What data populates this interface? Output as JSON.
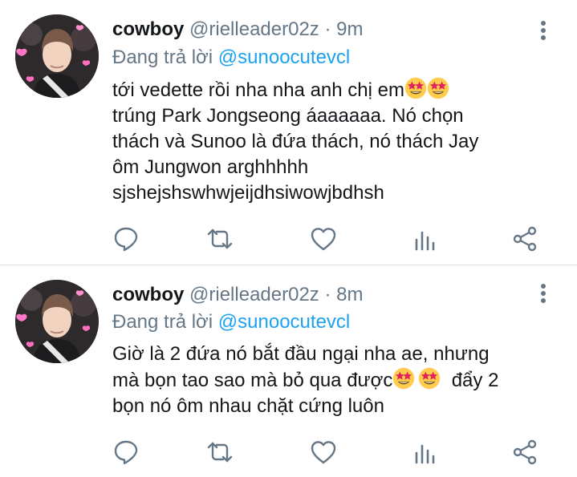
{
  "tweets": [
    {
      "display_name": "cowboy",
      "handle": "@rielleader02z",
      "separator": "·",
      "time": "9m",
      "reply_prefix": "Đang trả lời",
      "reply_to": "@sunoocutevcl",
      "lines": [
        "tới vedette rồi nha nha anh chị em",
        "trúng Park Jongseong áaaaaaa. Nó chọn",
        "thách và Sunoo là đứa thách, nó thách Jay",
        "ôm Jungwon arghhhhh",
        "sjshejshswhwjeijdhsiwowjbdhsh"
      ],
      "emoji": [
        "star-struck-emoji",
        "star-struck-emoji"
      ]
    },
    {
      "display_name": "cowboy",
      "handle": "@rielleader02z",
      "separator": "·",
      "time": "8m",
      "reply_prefix": "Đang trả lời",
      "reply_to": "@sunoocutevcl",
      "lines": [
        "Giờ là 2 đứa nó bắt đầu ngại nha ae, nhưng",
        "mà bọn tao sao mà bỏ qua được",
        "đẩy 2",
        "bọn nó ôm nhau chặt cứng luôn"
      ],
      "emoji": [
        "star-struck-emoji",
        "star-struck-emoji"
      ]
    }
  ],
  "actions": [
    "reply-icon",
    "retweet-icon",
    "like-icon",
    "analytics-icon",
    "share-icon"
  ],
  "colors": {
    "icon": "#657786",
    "link": "#1da1f2",
    "divider": "#dfe3e8",
    "text": "#14171a"
  }
}
